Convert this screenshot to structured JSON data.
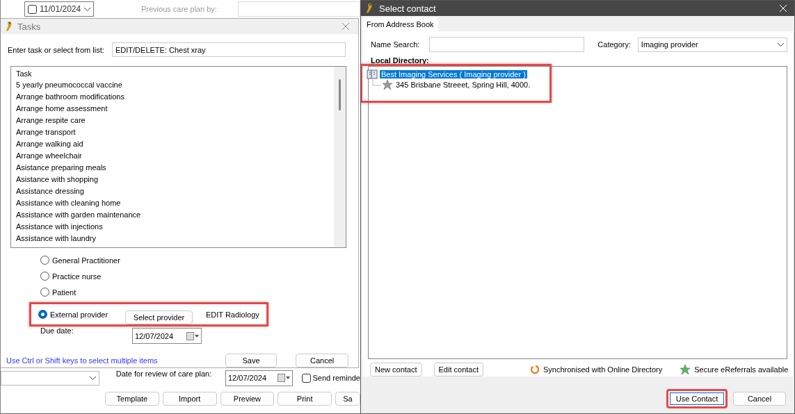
{
  "background_form": {
    "date_picker": {
      "value": "11/01/2024",
      "checked": false
    },
    "previous_care_plan_label": "Previous care plan by:",
    "review_date_label": "Date for review of care plan:",
    "review_date": "12/07/2024",
    "send_reminder": {
      "label": "Send reminde",
      "checked": false
    },
    "buttons": [
      "Template",
      "Import",
      "Preview",
      "Print",
      "Sa"
    ]
  },
  "tasks_dialog": {
    "title": "Tasks",
    "task_label": "Enter task or select from list:",
    "task_value": "EDIT/DELETE: Chest xray",
    "list_header": "Task",
    "tasks": [
      "5 yearly pneumococcal vaccine",
      "Arrange bathroom modifications",
      "Arrange home assessment",
      "Arrange respite care",
      "Arrange transport",
      "Arrange walking aid",
      "Arrange wheelchair",
      "Asistance preparing meals",
      "Asistance with shopping",
      "Assistance dressing",
      "Assistance with cleaning home",
      "Assistance with garden maintenance",
      "Assistance with injections",
      "Assistance with laundry"
    ],
    "assignees": [
      {
        "label": "General Practitioner",
        "selected": false
      },
      {
        "label": "Practice nurse",
        "selected": false
      },
      {
        "label": "Patient",
        "selected": false
      }
    ],
    "external_provider": {
      "label": "External provider",
      "selected": true,
      "highlighted": true,
      "button": "Select provider",
      "provider_name": "EDIT Radiology"
    },
    "due_date_label": "Due date:",
    "due_date": "12/07/2024",
    "hint": "Use Ctrl or Shift keys to select multiple items",
    "buttons": [
      "Save",
      "Cancel"
    ]
  },
  "select_contact_dialog": {
    "title": "Select contact",
    "tab": {
      "label": "From Address Book",
      "selected": true
    },
    "name_search_label": "Name Search:",
    "category_label": "Category:",
    "category_value": "Imaging provider",
    "directory": {
      "label": "Local Directory:",
      "highlighted": true,
      "entries": [
        {
          "name": "Best Imaging Services  ( Imaging provider )",
          "selected": true,
          "children": [
            {
              "name": "345 Brisbane Streeet, Spring Hill, 4000.",
              "selected": false
            }
          ]
        }
      ]
    },
    "contact_buttons": [
      "New contact",
      "Edit contact"
    ],
    "sync_status": "Synchronised with Online Directory",
    "ereferrals_status": "Secure eReferrals available",
    "footer_buttons": [
      {
        "label": "Use Contact",
        "highlighted": true
      },
      {
        "label": "Cancel",
        "highlighted": false
      }
    ]
  }
}
